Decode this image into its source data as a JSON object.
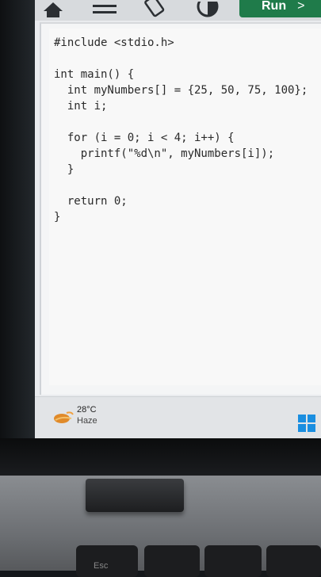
{
  "toolbar": {
    "icons": [
      "home-icon",
      "menu-icon",
      "rotate-icon",
      "contrast-icon"
    ],
    "run_label": "Run",
    "run_chevron": ">",
    "accent_color": "#1f7b4a"
  },
  "editor": {
    "lines": [
      "#include <stdio.h>",
      "",
      "int main() {",
      "  int myNumbers[] = {25, 50, 75, 100};",
      "  int i;",
      "",
      "  for (i = 0; i < 4; i++) {",
      "    printf(\"%d\\n\", myNumbers[i]);",
      "  }",
      "",
      "  return 0;",
      "}"
    ]
  },
  "taskbar": {
    "weather_icon": "weather-haze-icon",
    "temperature": "28°C",
    "condition": "Haze",
    "start_icon": "windows-start-icon"
  },
  "keyboard": {
    "esc_label": "Esc"
  }
}
